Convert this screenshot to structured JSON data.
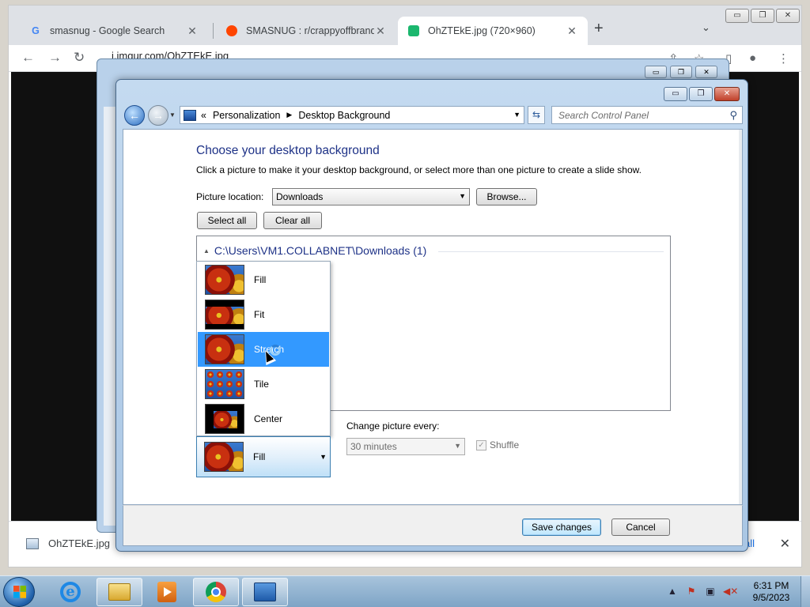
{
  "browser": {
    "tabs": [
      {
        "title": "smasnug - Google Search",
        "favicon": "google-icon"
      },
      {
        "title": "SMASNUG : r/crappyoffbrands",
        "favicon": "reddit-icon"
      },
      {
        "title": "OhZTEkE.jpg (720×960)",
        "favicon": "imgur-icon",
        "active": true
      }
    ],
    "url": "i.imgur.com/OhZTEkE.jpg",
    "download": {
      "filename": "OhZTEkE.jpg",
      "show_all": "all"
    }
  },
  "window": {
    "breadcrumb": [
      "Personalization",
      "Desktop Background"
    ],
    "breadcrumb_prefix": "«",
    "search_placeholder": "Search Control Panel"
  },
  "page": {
    "heading": "Choose your desktop background",
    "description": "Click a picture to make it your desktop background, or select more than one picture to create a slide show.",
    "picture_location_label": "Picture location:",
    "picture_location_value": "Downloads",
    "browse_label": "Browse...",
    "select_all_label": "Select all",
    "clear_all_label": "Clear all",
    "folder_path": "C:\\Users\\VM1.COLLABNET\\Downloads (1)",
    "picture_position": {
      "options": [
        "Fill",
        "Fit",
        "Stretch",
        "Tile",
        "Center"
      ],
      "highlighted": "Stretch",
      "selected": "Fill"
    },
    "change_picture_label": "Change picture every:",
    "change_picture_value": "30 minutes",
    "shuffle_label": "Shuffle",
    "save_label": "Save changes",
    "cancel_label": "Cancel"
  },
  "taskbar": {
    "clock_time": "6:31 PM",
    "clock_date": "9/5/2023",
    "apps": [
      "internet-explorer-icon",
      "explorer-folder-icon",
      "media-player-icon",
      "chrome-icon",
      "control-panel-icon"
    ]
  }
}
